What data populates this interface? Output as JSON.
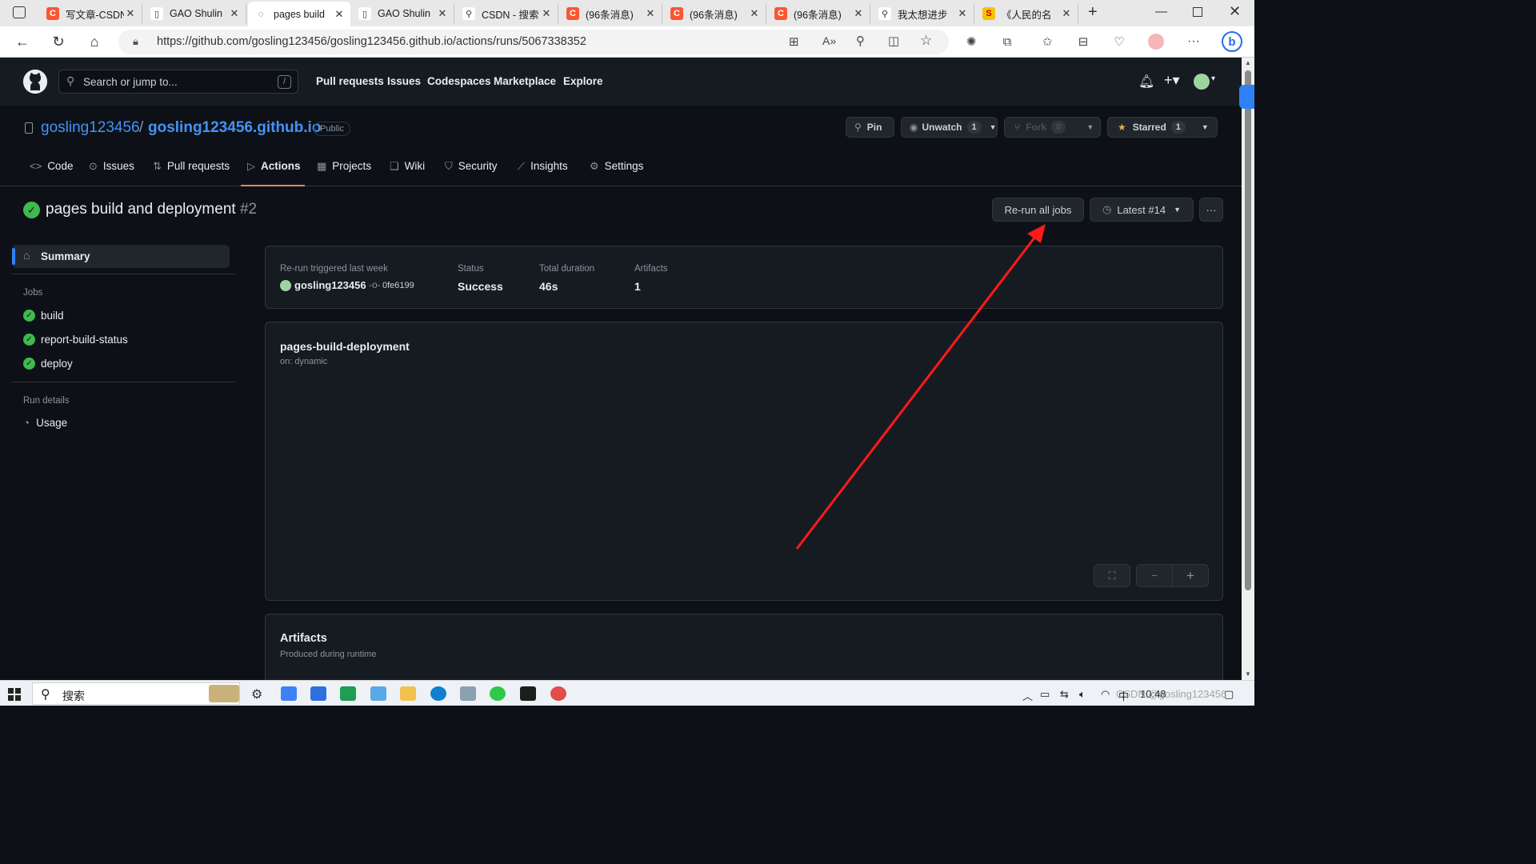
{
  "browser": {
    "tabs": [
      {
        "title": "写文章-CSDN",
        "icon": "csdn-icon",
        "color": "#fc5531",
        "glyph": "C"
      },
      {
        "title": "GAO Shulin",
        "icon": "document-icon",
        "color": "#ffffff",
        "glyph": "▯"
      },
      {
        "title": "pages build",
        "icon": "loading-icon",
        "color": "#ffffff",
        "glyph": "◌"
      },
      {
        "title": "GAO Shulin",
        "icon": "document-icon",
        "color": "#ffffff",
        "glyph": "▯"
      },
      {
        "title": "CSDN - 搜索",
        "icon": "search-icon",
        "color": "#ffffff",
        "glyph": "⚲"
      },
      {
        "title": "(96条消息)",
        "icon": "csdn-icon",
        "color": "#fc5531",
        "glyph": "C"
      },
      {
        "title": "(96条消息)",
        "icon": "csdn-icon",
        "color": "#fc5531",
        "glyph": "C"
      },
      {
        "title": "(96条消息)",
        "icon": "csdn-icon",
        "color": "#fc5531",
        "glyph": "C"
      },
      {
        "title": "我太想进步",
        "icon": "search-icon",
        "color": "#ffffff",
        "glyph": "⚲"
      },
      {
        "title": "《人民的名",
        "icon": "app-icon",
        "color": "#f5c400",
        "glyph": "S"
      }
    ],
    "url": "https://github.com/gosling123456/gosling123456.github.io/actions/runs/5067338352"
  },
  "github_header": {
    "search_placeholder": "Search or jump to...",
    "search_shortcut": "/",
    "nav": [
      "Pull requests",
      "Issues",
      "Codespaces",
      "Marketplace",
      "Explore"
    ]
  },
  "repo": {
    "owner": "gosling123456",
    "separator": "/",
    "name": "gosling123456.github.io",
    "visibility": "Public",
    "pin_label": "Pin",
    "watch_label": "Unwatch",
    "watch_count": "1",
    "fork_label": "Fork",
    "fork_count": "0",
    "star_label": "Starred",
    "star_count": "1",
    "tabs": [
      {
        "label": "Code",
        "icon": "code-icon",
        "glyph": "<>"
      },
      {
        "label": "Issues",
        "icon": "issue-icon",
        "glyph": "⊙"
      },
      {
        "label": "Pull requests",
        "icon": "pull-request-icon",
        "glyph": "⇅"
      },
      {
        "label": "Actions",
        "icon": "play-icon",
        "glyph": "▷"
      },
      {
        "label": "Projects",
        "icon": "table-icon",
        "glyph": "▦"
      },
      {
        "label": "Wiki",
        "icon": "book-icon",
        "glyph": "❑"
      },
      {
        "label": "Security",
        "icon": "shield-icon",
        "glyph": "⛉"
      },
      {
        "label": "Insights",
        "icon": "graph-icon",
        "glyph": "⟋"
      },
      {
        "label": "Settings",
        "icon": "gear-icon",
        "glyph": "⚙"
      }
    ],
    "selected_tab": "Actions"
  },
  "run": {
    "title": "pages build and deployment",
    "number": "#2",
    "rerun_label": "Re-run all jobs",
    "latest_label": "Latest #14",
    "more_label": "···"
  },
  "sidebar": {
    "summary": "Summary",
    "jobs_heading": "Jobs",
    "jobs": [
      "build",
      "report-build-status",
      "deploy"
    ],
    "run_details_heading": "Run details",
    "usage": "Usage"
  },
  "summary_card": {
    "trigger_label": "Re-run triggered last week",
    "user": "gosling123456",
    "commit": "0fe6199",
    "status_label": "Status",
    "status_value": "Success",
    "duration_label": "Total duration",
    "duration_value": "46s",
    "artifacts_label": "Artifacts",
    "artifacts_value": "1"
  },
  "workflow_card": {
    "name": "pages-build-deployment",
    "trigger": "on: dynamic",
    "fullscreen": "⛶",
    "zoom_out": "−",
    "zoom_in": "+"
  },
  "artifacts_card": {
    "title": "Artifacts",
    "subtitle": "Produced during runtime"
  },
  "taskbar": {
    "search_label": "搜索",
    "ime": "中",
    "time": "10:48",
    "watermark": "CSDN @gosling123456"
  },
  "colors": {
    "accent": "#f78166",
    "link": "#4493f8",
    "success": "#3fb950",
    "arrow": "#ff1a1a"
  }
}
